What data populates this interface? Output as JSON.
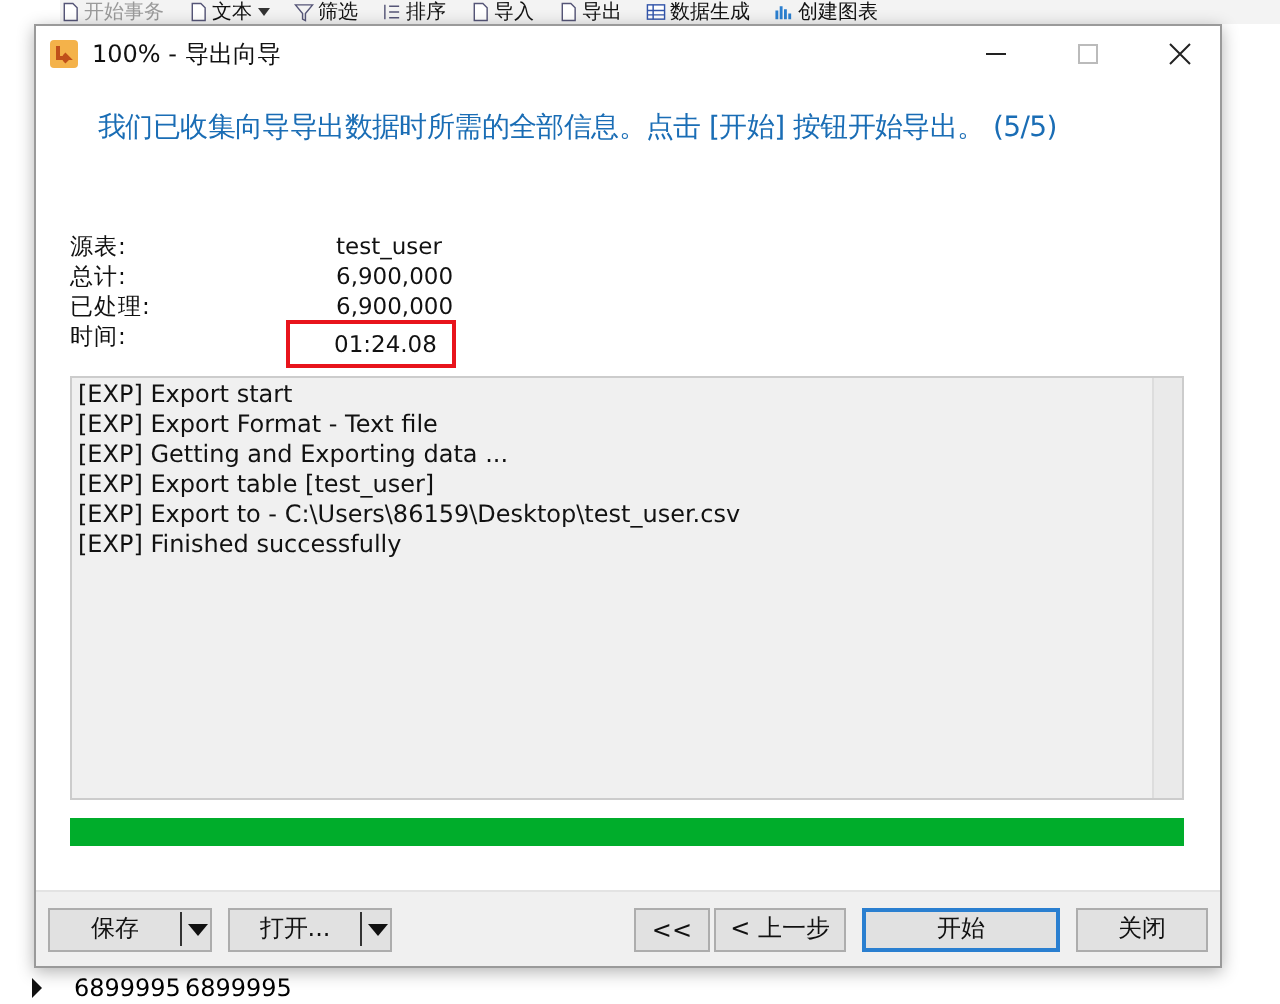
{
  "background_app": {
    "toolbar": [
      {
        "label": "开始事务",
        "disabled": true,
        "kind": "doc",
        "dropdown": false
      },
      {
        "label": "文本",
        "disabled": false,
        "kind": "doc",
        "dropdown": true
      },
      {
        "label": "筛选",
        "disabled": false,
        "kind": "filter",
        "dropdown": false
      },
      {
        "label": "排序",
        "disabled": false,
        "kind": "list",
        "dropdown": false
      },
      {
        "label": "导入",
        "disabled": false,
        "kind": "doc",
        "dropdown": false
      },
      {
        "label": "导出",
        "disabled": false,
        "kind": "doc",
        "dropdown": false
      },
      {
        "label": "数据生成",
        "disabled": false,
        "kind": "grid",
        "dropdown": false
      },
      {
        "label": "创建图表",
        "disabled": false,
        "kind": "chart",
        "dropdown": false
      }
    ],
    "rows": [
      {
        "current": true,
        "cells": [
          "6899995",
          "6899995"
        ]
      }
    ]
  },
  "dialog": {
    "title": "100% - 导出向导",
    "heading": "我们已收集向导导出数据时所需的全部信息。点击 [开始] 按钮开始导出。 (5/5)",
    "summary": [
      {
        "label": "源表:",
        "value": "test_user",
        "highlighted": false
      },
      {
        "label": "总计:",
        "value": "6,900,000",
        "highlighted": false
      },
      {
        "label": "已处理:",
        "value": "6,900,000",
        "highlighted": false
      },
      {
        "label": "时间:",
        "value": "01:24.08",
        "highlighted": true
      }
    ],
    "log": [
      "[EXP] Export start",
      "[EXP] Export Format - Text file",
      "[EXP] Getting and Exporting data ...",
      "[EXP] Export table [test_user]",
      "[EXP] Export to - C:\\Users\\86159\\Desktop\\test_user.csv",
      "[EXP] Finished successfully"
    ],
    "progress": {
      "level": 1
    },
    "buttons": [
      {
        "label": "保存",
        "kind": "split",
        "default": false
      },
      {
        "label": "打开...",
        "kind": "split",
        "default": false
      },
      {
        "label": "<<",
        "kind": "nav",
        "default": false
      },
      {
        "label": "< 上一步",
        "kind": "nav",
        "default": false
      },
      {
        "label": "开始",
        "kind": "plain",
        "default": true
      },
      {
        "label": "关闭",
        "kind": "plain",
        "default": false
      }
    ]
  }
}
